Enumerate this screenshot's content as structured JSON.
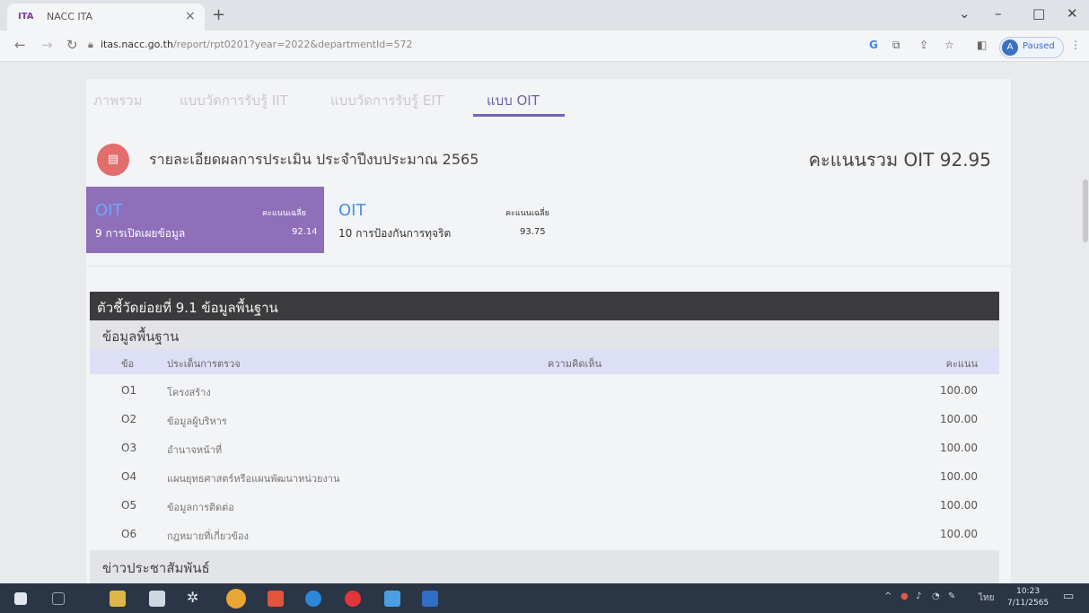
{
  "browser": {
    "tab_logo": "ITA",
    "tab_title": "NACC ITA",
    "tab_close": "×",
    "new_tab": "+",
    "url_host": "itas.nacc.go.th",
    "url_path": "/report/rpt0201?year=2022&departmentId=572",
    "profile_initial": "A",
    "profile_status": "Paused"
  },
  "nav_tabs": [
    {
      "label": "ภาพรวม"
    },
    {
      "label": "แบบวัดการรับรู้ IIT"
    },
    {
      "label": "แบบวัดการรับรู้ EIT"
    },
    {
      "label": "แบบ OIT",
      "active": true
    }
  ],
  "report": {
    "title": "รายละเอียดผลการประเมิน ประจำปีงบประมาณ 2565",
    "total_score": "คะแนนรวม OIT 92.95"
  },
  "cards": [
    {
      "tag": "OIT",
      "score_label": "คะแนนเฉลี่ย",
      "name": "9 การเปิดเผยข้อมูล",
      "score": "92.14",
      "active": true
    },
    {
      "tag": "OIT",
      "score_label": "คะแนนเฉลี่ย",
      "name": "10 การป้องกันการทุจริต",
      "score": "93.75",
      "active": false
    }
  ],
  "indicator": {
    "header": "ตัวชี้วัดย่อยที่ 9.1 ข้อมูลพื้นฐาน",
    "section": "ข้อมูลพื้นฐาน",
    "columns": {
      "no": "ข้อ",
      "issue": "ประเด็นการตรวจ",
      "comment": "ความคิดเห็น",
      "score": "คะแนน"
    },
    "rows": [
      {
        "no": "O1",
        "issue": "โครงสร้าง",
        "score": "100.00"
      },
      {
        "no": "O2",
        "issue": "ข้อมูลผู้บริหาร",
        "score": "100.00"
      },
      {
        "no": "O3",
        "issue": "อำนาจหน้าที่",
        "score": "100.00"
      },
      {
        "no": "O4",
        "issue": "แผนยุทธศาสตร์หรือแผนพัฒนาหน่วยงาน",
        "score": "100.00"
      },
      {
        "no": "O5",
        "issue": "ข้อมูลการติดต่อ",
        "score": "100.00"
      },
      {
        "no": "O6",
        "issue": "กฎหมายที่เกี่ยวข้อง",
        "score": "100.00"
      }
    ],
    "next_section": "ข่าวประชาสัมพันธ์"
  },
  "taskbar": {
    "clock_time": "10:23",
    "clock_date": "7/11/2565",
    "lang": "ไทย"
  }
}
